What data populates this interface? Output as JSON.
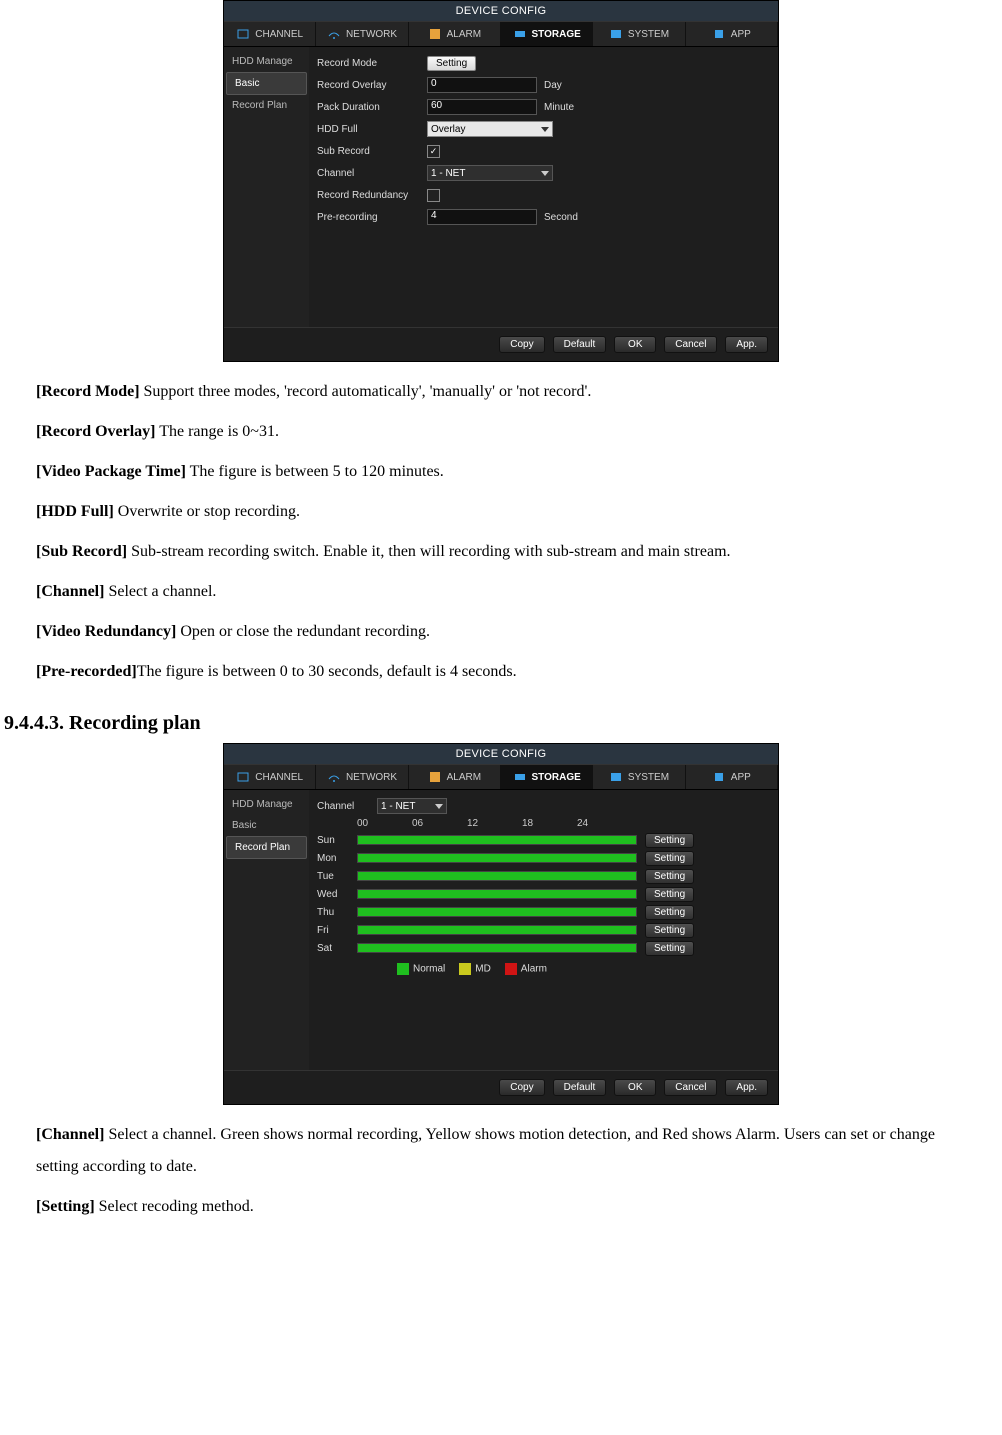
{
  "shot1": {
    "title": "DEVICE CONFIG",
    "tabs": [
      "CHANNEL",
      "NETWORK",
      "ALARM",
      "STORAGE",
      "SYSTEM",
      "APP"
    ],
    "activeTab": "STORAGE",
    "side": [
      "HDD Manage",
      "Basic",
      "Record Plan"
    ],
    "sideActive": "Basic",
    "rows": {
      "recordMode": {
        "label": "Record Mode",
        "button": "Setting"
      },
      "recordOverlay": {
        "label": "Record Overlay",
        "value": "0",
        "unit": "Day"
      },
      "packDuration": {
        "label": "Pack Duration",
        "value": "60",
        "unit": "Minute"
      },
      "hddFull": {
        "label": "HDD Full",
        "value": "Overlay"
      },
      "subRecord": {
        "label": "Sub Record",
        "checked": true
      },
      "channel": {
        "label": "Channel",
        "value": "1 - NET"
      },
      "recordRedundancy": {
        "label": "Record Redundancy",
        "checked": false
      },
      "preRecording": {
        "label": "Pre-recording",
        "value": "4",
        "unit": "Second"
      }
    },
    "footer": [
      "Copy",
      "Default",
      "OK",
      "Cancel",
      "App."
    ]
  },
  "descriptions1": [
    {
      "b": "[Record Mode]",
      "t": " Support three modes, 'record automatically', 'manually' or 'not record'."
    },
    {
      "b": "[Record Overlay]",
      "t": " The range is 0~31."
    },
    {
      "b": "[Video Package Time]",
      "t": " The figure is between 5 to 120 minutes."
    },
    {
      "b": "[HDD Full]",
      "t": " Overwrite or stop recording."
    },
    {
      "b": "[Sub Record]",
      "t": " Sub-stream recording switch. Enable it, then will recording with sub-stream and main stream."
    },
    {
      "b": "[Channel]",
      "t": " Select a channel."
    },
    {
      "b": "[Video Redundancy]",
      "t": " Open or close the redundant recording."
    },
    {
      "b": "[Pre-recorded]",
      "t": "The figure is between 0 to 30 seconds, default is 4 seconds."
    }
  ],
  "sectionHeading": "9.4.4.3. Recording plan",
  "shot2": {
    "title": "DEVICE CONFIG",
    "tabs": [
      "CHANNEL",
      "NETWORK",
      "ALARM",
      "STORAGE",
      "SYSTEM",
      "APP"
    ],
    "activeTab": "STORAGE",
    "side": [
      "HDD Manage",
      "Basic",
      "Record Plan"
    ],
    "sideActive": "Record Plan",
    "channelLabel": "Channel",
    "channelValue": "1 - NET",
    "timeTicks": [
      "00",
      "06",
      "12",
      "18",
      "24"
    ],
    "days": [
      "Sun",
      "Mon",
      "Tue",
      "Wed",
      "Thu",
      "Fri",
      "Sat"
    ],
    "rowButton": "Setting",
    "legend": [
      {
        "name": "Normal",
        "color": "#1fbf1f"
      },
      {
        "name": "MD",
        "color": "#c9c91e"
      },
      {
        "name": "Alarm",
        "color": "#d01414"
      }
    ],
    "footer": [
      "Copy",
      "Default",
      "OK",
      "Cancel",
      "App."
    ]
  },
  "descriptions2": [
    {
      "b": "[Channel]",
      "t": " Select a channel. Green shows normal recording, Yellow shows motion detection, and Red shows Alarm. Users can set or change setting according to date."
    },
    {
      "b": "[Setting]",
      "t": " Select recoding method."
    }
  ],
  "icons": {
    "channel": "#3aa0e8",
    "network": "#3aa0e8",
    "alarm": "#e6a23c",
    "storage": "#3aa0e8",
    "system": "#3aa0e8",
    "app": "#3aa0e8"
  }
}
